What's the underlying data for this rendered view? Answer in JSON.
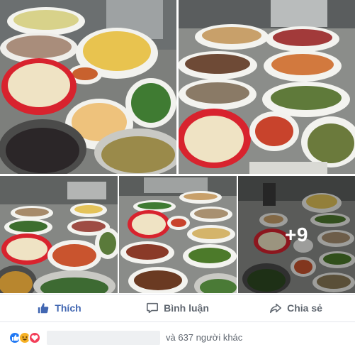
{
  "post": {
    "photos": [
      {
        "label": "food-buffet-photo-1"
      },
      {
        "label": "food-buffet-photo-2"
      },
      {
        "label": "food-buffet-photo-3"
      },
      {
        "label": "food-buffet-photo-4"
      },
      {
        "label": "food-buffet-photo-5"
      }
    ],
    "more_photos": "+9"
  },
  "actions": {
    "like_label": "Thích",
    "comment_label": "Bình luận",
    "share_label": "Chia sẻ"
  },
  "reactions": {
    "icons": [
      "like-reaction-icon",
      "haha-reaction-icon",
      "love-reaction-icon"
    ],
    "others_text": "và 637 người khác"
  },
  "colors": {
    "like_blue": "#4267b2",
    "text_gray": "#606770",
    "reaction_like": "#2078f4",
    "reaction_haha": "#f7b125",
    "reaction_love": "#f33e58"
  }
}
